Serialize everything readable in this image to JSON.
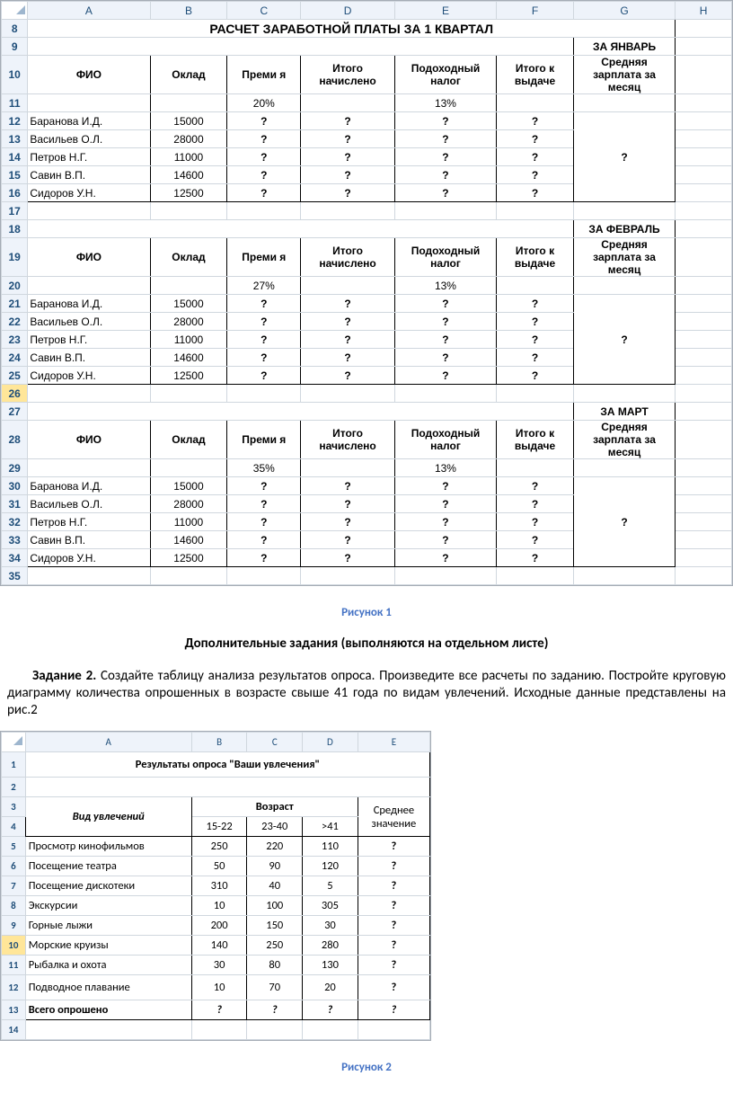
{
  "fig1": {
    "cols": [
      "A",
      "B",
      "C",
      "D",
      "E",
      "F",
      "G",
      "H"
    ],
    "title": "РАСЧЕТ ЗАРАБОТНОЙ ПЛАТЫ ЗА 1  КВАРТАЛ",
    "months": [
      "ЗА ЯНВАРЬ",
      "ЗА ФЕВРАЛЬ",
      "ЗА МАРТ"
    ],
    "head": {
      "fio": "ФИО",
      "oklad": "Оклад",
      "prem": "Преми я",
      "itogo_n": "Итого начислено",
      "podoh": "Подоходный налог",
      "itogo_v": "Итого к выдаче",
      "sred": "Средняя зарплата за месяц"
    },
    "tax": "13%",
    "prem_pct": [
      "20%",
      "27%",
      "35%"
    ],
    "rows_start": [
      8,
      18,
      27
    ],
    "people": [
      {
        "n": "Баранова И.Д.",
        "o": "15000"
      },
      {
        "n": "Васильев О.Л.",
        "o": "28000"
      },
      {
        "n": "Петров Н.Г.",
        "o": "11000"
      },
      {
        "n": "Савин В.П.",
        "o": "14600"
      },
      {
        "n": "Сидоров У.Н.",
        "o": "12500"
      }
    ],
    "q": "?",
    "caption": "Рисунок 1"
  },
  "doc": {
    "heading": "Дополнительные задания (выполняются на отдельном листе)",
    "task_label": "Задание 2.",
    "task_text": " Создайте таблицу анализа результатов опроса. Произведите все расчеты по заданию. Постройте круговую диаграмму количества опрошенных в возрасте свыше 41 года по видам увлечений. Исходные данные представлены на рис.2"
  },
  "fig2": {
    "cols": [
      "A",
      "B",
      "C",
      "D",
      "E"
    ],
    "title": "Результаты опроса \"Ваши увлечения\"",
    "head": {
      "vid": "Вид увлечений",
      "voz": "Возраст",
      "a1": "15-22",
      "a2": "23-40",
      "a3": ">41",
      "avg": "Среднее значение"
    },
    "rows": [
      {
        "n": "Просмотр кинофильмов",
        "v": [
          "250",
          "220",
          "110"
        ]
      },
      {
        "n": "Посещение театра",
        "v": [
          "50",
          "90",
          "120"
        ]
      },
      {
        "n": "Посещение дискотеки",
        "v": [
          "310",
          "40",
          "5"
        ]
      },
      {
        "n": "Экскурсии",
        "v": [
          "10",
          "100",
          "305"
        ]
      },
      {
        "n": "Горные лыжи",
        "v": [
          "200",
          "150",
          "30"
        ]
      },
      {
        "n": "Морские круизы",
        "v": [
          "140",
          "250",
          "280"
        ]
      },
      {
        "n": "Рыбалка и охота",
        "v": [
          "30",
          "80",
          "130"
        ]
      },
      {
        "n": "Подводное плавание",
        "v": [
          "10",
          "70",
          "20"
        ]
      }
    ],
    "total_label": "Всего опрошено",
    "q": "?",
    "caption": "Рисунок 2"
  },
  "chart_data": [
    {
      "type": "table",
      "title": "РАСЧЕТ ЗАРАБОТНОЙ ПЛАТЫ ЗА 1 КВАРТАЛ",
      "sections": [
        {
          "month": "ЗА ЯНВАРЬ",
          "premium_pct": 20,
          "tax_pct": 13,
          "salaries": {
            "Баранова И.Д.": 15000,
            "Васильев О.Л.": 28000,
            "Петров Н.Г.": 11000,
            "Савин В.П.": 14600,
            "Сидоров У.Н.": 12500
          }
        },
        {
          "month": "ЗА ФЕВРАЛЬ",
          "premium_pct": 27,
          "tax_pct": 13,
          "salaries": {
            "Баранова И.Д.": 15000,
            "Васильев О.Л.": 28000,
            "Петров Н.Г.": 11000,
            "Савин В.П.": 14600,
            "Сидоров У.Н.": 12500
          }
        },
        {
          "month": "ЗА МАРТ",
          "premium_pct": 35,
          "tax_pct": 13,
          "salaries": {
            "Баранова И.Д.": 15000,
            "Васильев О.Л.": 28000,
            "Петров Н.Г.": 11000,
            "Савин В.П.": 14600,
            "Сидоров У.Н.": 12500
          }
        }
      ]
    },
    {
      "type": "table",
      "title": "Результаты опроса \"Ваши увлечения\"",
      "columns": [
        "Вид увлечений",
        "15-22",
        "23-40",
        ">41"
      ],
      "rows": [
        [
          "Просмотр кинофильмов",
          250,
          220,
          110
        ],
        [
          "Посещение театра",
          50,
          90,
          120
        ],
        [
          "Посещение дискотеки",
          310,
          40,
          5
        ],
        [
          "Экскурсии",
          10,
          100,
          305
        ],
        [
          "Горные лыжи",
          200,
          150,
          30
        ],
        [
          "Морские круизы",
          140,
          250,
          280
        ],
        [
          "Рыбалка и охота",
          30,
          80,
          130
        ],
        [
          "Подводное плавание",
          10,
          70,
          20
        ]
      ]
    }
  ]
}
